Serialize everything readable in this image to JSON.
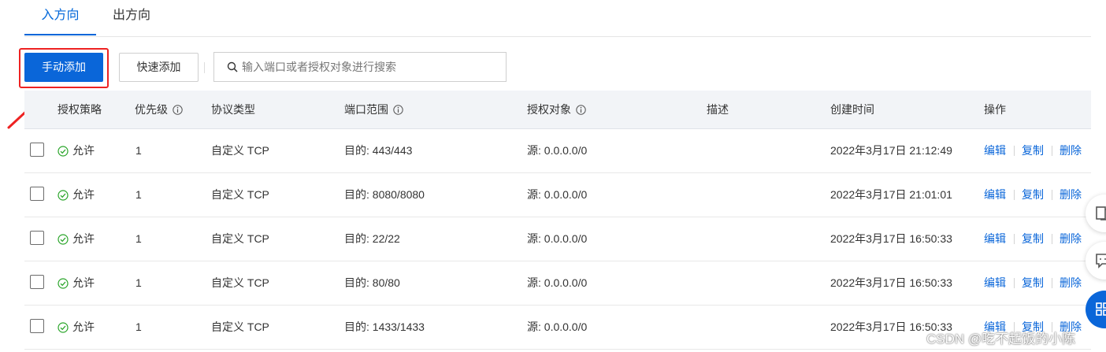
{
  "tabs": {
    "inbound": "入方向",
    "outbound": "出方向"
  },
  "toolbar": {
    "manual_add": "手动添加",
    "quick_add": "快速添加",
    "search_placeholder": "输入端口或者授权对象进行搜索"
  },
  "table": {
    "headers": {
      "policy": "授权策略",
      "priority": "优先级",
      "protocol": "协议类型",
      "port_range": "端口范围",
      "auth_object": "授权对象",
      "description": "描述",
      "created": "创建时间",
      "actions": "操作"
    },
    "rows": [
      {
        "policy": "允许",
        "priority": "1",
        "protocol": "自定义 TCP",
        "port": "目的: 443/443",
        "source": "源: 0.0.0.0/0",
        "created": "2022年3月17日 21:12:49"
      },
      {
        "policy": "允许",
        "priority": "1",
        "protocol": "自定义 TCP",
        "port": "目的: 8080/8080",
        "source": "源: 0.0.0.0/0",
        "created": "2022年3月17日 21:01:01"
      },
      {
        "policy": "允许",
        "priority": "1",
        "protocol": "自定义 TCP",
        "port": "目的: 22/22",
        "source": "源: 0.0.0.0/0",
        "created": "2022年3月17日 16:50:33"
      },
      {
        "policy": "允许",
        "priority": "1",
        "protocol": "自定义 TCP",
        "port": "目的: 80/80",
        "source": "源: 0.0.0.0/0",
        "created": "2022年3月17日 16:50:33"
      },
      {
        "policy": "允许",
        "priority": "1",
        "protocol": "自定义 TCP",
        "port": "目的: 1433/1433",
        "source": "源: 0.0.0.0/0",
        "created": "2022年3月17日 16:50:33"
      }
    ],
    "row_actions": {
      "edit": "编辑",
      "copy": "复制",
      "delete": "删除"
    }
  },
  "watermark": "CSDN @吃不起饭的小陈",
  "colors": {
    "accent": "#0a66d9",
    "highlight": "#e22222",
    "allow_green": "#2aa52a",
    "header_bg": "#f2f4f7"
  },
  "icons": {
    "search": "search-icon",
    "info": "info-circle-icon",
    "allow": "check-circle-icon",
    "annotation": "red-arrow-icon",
    "float": [
      "book-icon",
      "message-icon",
      "grid-icon"
    ]
  }
}
